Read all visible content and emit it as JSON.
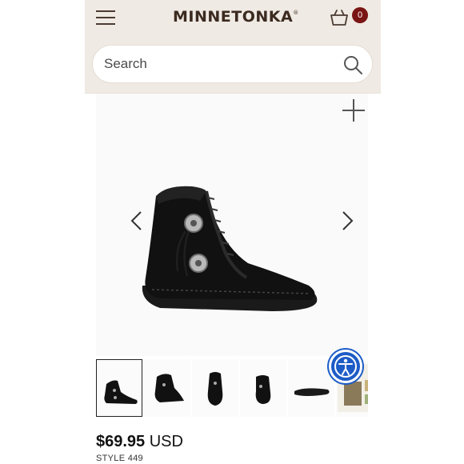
{
  "header": {
    "brand": "MINNETONKA",
    "trademark": "®",
    "menu_icon": "hamburger-menu-icon",
    "cart_icon": "shopping-basket-icon",
    "cart_count": "0"
  },
  "search": {
    "placeholder": "Search",
    "icon": "search-icon"
  },
  "gallery": {
    "zoom_icon": "plus-icon",
    "prev_icon": "chevron-left-icon",
    "next_icon": "chevron-right-icon",
    "thumbnails": [
      {
        "name": "side-view",
        "active": true
      },
      {
        "name": "angle-view",
        "active": false
      },
      {
        "name": "front-view",
        "active": false
      },
      {
        "name": "back-view",
        "active": false
      },
      {
        "name": "sole-view",
        "active": false
      },
      {
        "name": "lifestyle-view",
        "active": false
      }
    ]
  },
  "accessibility": {
    "icon": "accessibility-icon"
  },
  "product": {
    "price": "$69.95",
    "currency": "USD",
    "style": "STYLE 449"
  },
  "colors": {
    "header_bg": "#efeae3",
    "brand": "#3b2a20",
    "badge": "#7a1515",
    "accessibility": "#1d5cc7"
  }
}
